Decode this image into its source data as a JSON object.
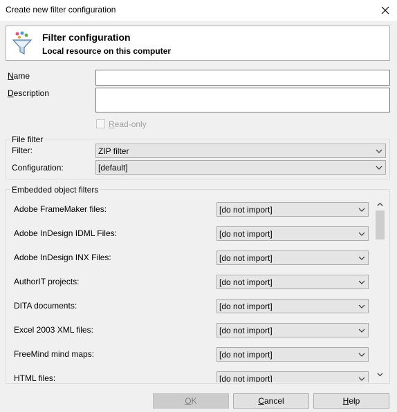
{
  "window": {
    "title": "Create new filter configuration"
  },
  "header": {
    "icon": "filter-funnel-icon",
    "title": "Filter configuration",
    "subtitle": "Local resource on this computer"
  },
  "form": {
    "name_label_first": "N",
    "name_label_rest": "ame",
    "name_value": "",
    "description_label_first": "D",
    "description_label_rest": "escription",
    "description_value": "",
    "readonly_label_first": "R",
    "readonly_label_rest": "ead-only"
  },
  "file_filter": {
    "group_title": "File filter",
    "filter_label": "Filter:",
    "filter_value": "ZIP filter",
    "configuration_label": "Configuration:",
    "configuration_value": "[default]"
  },
  "embedded": {
    "group_title": "Embedded object filters",
    "rows": [
      {
        "label": "Adobe FrameMaker files:",
        "value": "[do not import]"
      },
      {
        "label": "Adobe InDesign IDML Files:",
        "value": "[do not import]"
      },
      {
        "label": "Adobe InDesign INX Files:",
        "value": "[do not import]"
      },
      {
        "label": "AuthorIT projects:",
        "value": "[do not import]"
      },
      {
        "label": "DITA documents:",
        "value": "[do not import]"
      },
      {
        "label": "Excel 2003 XML files:",
        "value": "[do not import]"
      },
      {
        "label": "FreeMind mind maps:",
        "value": "[do not import]"
      },
      {
        "label": "HTML files:",
        "value": "[do not import]"
      }
    ]
  },
  "buttons": {
    "ok_first": "O",
    "ok_rest": "K",
    "cancel_first": "C",
    "cancel_rest": "ancel",
    "help_first": "H",
    "help_rest": "elp"
  },
  "colors": {
    "window_bg": "#f0f0f0",
    "combo_bg": "#e5e5e5",
    "disabled_text": "#a0a0a0"
  }
}
